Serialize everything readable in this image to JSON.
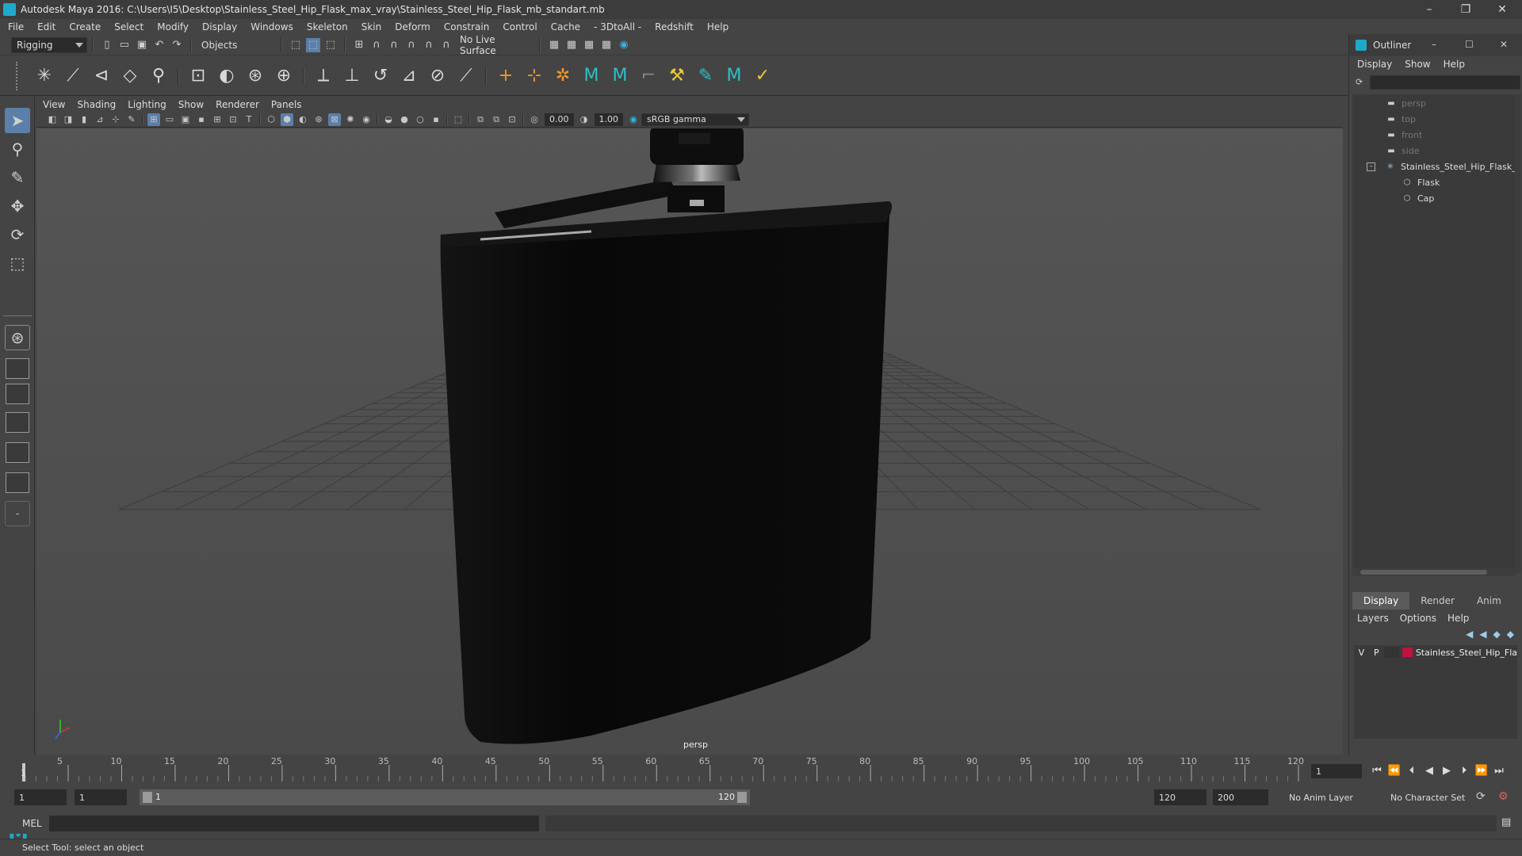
{
  "window": {
    "title": "Autodesk Maya 2016: C:\\Users\\I5\\Desktop\\Stainless_Steel_Hip_Flask_max_vray\\Stainless_Steel_Hip_Flask_mb_standart.mb",
    "minimize": "–",
    "restore": "❐",
    "close": "✕"
  },
  "menubar": [
    "File",
    "Edit",
    "Create",
    "Select",
    "Modify",
    "Display",
    "Windows",
    "Skeleton",
    "Skin",
    "Deform",
    "Constrain",
    "Control",
    "Cache",
    "- 3DtoAll -",
    "Redshift",
    "Help"
  ],
  "statusline": {
    "menuset": "Rigging",
    "selection_mode": "Objects",
    "live_surface": "No Live Surface"
  },
  "panel": {
    "menu": [
      "View",
      "Shading",
      "Lighting",
      "Show",
      "Renderer",
      "Panels"
    ],
    "exposure": "0.00",
    "gamma": "1.00",
    "color_space": "sRGB gamma",
    "camera_label": "persp"
  },
  "outliner": {
    "title": "Outliner",
    "menu": [
      "Display",
      "Show",
      "Help"
    ],
    "items": [
      {
        "label": "persp",
        "type": "camera"
      },
      {
        "label": "top",
        "type": "camera"
      },
      {
        "label": "front",
        "type": "camera"
      },
      {
        "label": "side",
        "type": "camera"
      },
      {
        "label": "Stainless_Steel_Hip_Flask_r",
        "type": "group"
      },
      {
        "label": "Flask",
        "type": "mesh"
      },
      {
        "label": "Cap",
        "type": "mesh"
      }
    ]
  },
  "layer_editor": {
    "tabs": [
      "Display",
      "Render",
      "Anim"
    ],
    "active_tab": "Display",
    "menu": [
      "Layers",
      "Options",
      "Help"
    ],
    "layer": {
      "visible": "V",
      "playback": "P",
      "name": "Stainless_Steel_Hip_Fla",
      "color": "#c0143c"
    }
  },
  "timeline": {
    "ticks": [
      "5",
      "10",
      "15",
      "20",
      "25",
      "30",
      "35",
      "40",
      "45",
      "50",
      "55",
      "60",
      "65",
      "70",
      "75",
      "80",
      "85",
      "90",
      "95",
      "100",
      "105",
      "110",
      "115",
      "120"
    ],
    "start_marker": "1",
    "current_frame": "1"
  },
  "range": {
    "start": "1",
    "playback_start": "1",
    "slider_start": "1",
    "slider_end": "120",
    "playback_end": "120",
    "end": "200",
    "anim_layer": "No Anim Layer",
    "character_set": "No Character Set"
  },
  "cmdline": {
    "label": "MEL"
  },
  "helpline": "Select Tool: select an object"
}
